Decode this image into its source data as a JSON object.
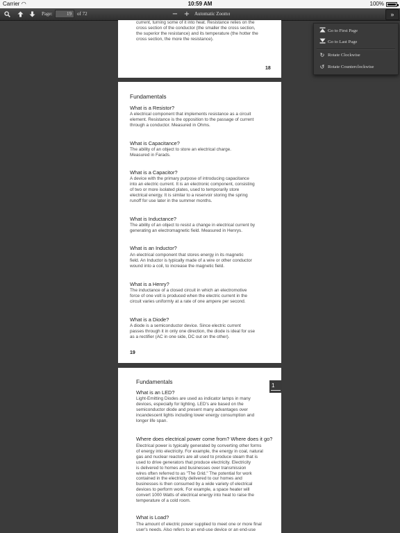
{
  "status": {
    "carrier": "Carrier",
    "time": "10:59 AM",
    "battery": "100%"
  },
  "toolbar": {
    "page_label": "Page:",
    "page_value": "19",
    "page_count": "of 72",
    "zoom_out": "−",
    "zoom_in": "+",
    "zoom": "Automatic Zoom",
    "icons": [
      "search-icon",
      "arrow-up-icon",
      "arrow-down-icon",
      "minus-icon",
      "plus-icon",
      "double-chevron-right-icon"
    ]
  },
  "menu": {
    "items": [
      {
        "label": "Go to First Page",
        "icon": "first-page-icon"
      },
      {
        "label": "Go to Last Page",
        "icon": "last-page-icon"
      },
      {
        "label": "Rotate Clockwise",
        "icon": "rotate-clockwise-icon"
      },
      {
        "label": "Rotate Counterclockwise",
        "icon": "rotate-counterclockwise-icon"
      }
    ]
  },
  "pages": {
    "p18": {
      "lines": [
        "current, turning some of it into heat. Resistance relies on the",
        "cross section of the conductor (the smaller the cross section,",
        "the superior the resistance) and its temperature (the hotter the",
        "cross section, the more the resistance)."
      ],
      "number": "18"
    },
    "p19": {
      "heading": "Fundamentals",
      "sections": [
        {
          "q": "What is a Resistor?",
          "lines": [
            "A electrical component that implements resistance as a circuit",
            "element. Resistance is the opposition to the passage of current",
            "through a conductor. Measured in Ohms."
          ]
        },
        {
          "q": "What is Capacitance?",
          "lines": [
            "The ability of an object to store an electrical charge.",
            "Measured in Farads."
          ]
        },
        {
          "q": "What is a Capacitor?",
          "lines": [
            "A device with the primary purpose of introducing capacitance",
            "into an electric current. It is an electronic component, consisting",
            "of two or more isolated plates, used to temporarily store",
            "electrical energy. It is similar to a reservoir storing the spring",
            "runoff for use later in the summer months."
          ]
        },
        {
          "q": "What is Inductance?",
          "lines": [
            "The ability of an object to resist a change in electrical current by",
            "generating an electromagnetic field. Measured in Henrys."
          ]
        },
        {
          "q": "What is an Inductor?",
          "lines": [
            "An electrical component that stores energy in its magnetic",
            "field. An Inductor is typically made of a wire or other conductor",
            "wound into a coil, to increase the magnetic field."
          ]
        },
        {
          "q": "What is a Henry?",
          "lines": [
            "The inductance of a closed circuit in which an electromotive",
            "force of one volt is produced when the electric current in the",
            "circuit varies uniformly at a rate of one ampere per second."
          ]
        },
        {
          "q": "What is a Diode?",
          "lines": [
            "A diode is a semiconductor device. Since electric current",
            "passes through it in only one direction, the diode is ideal for use",
            "as a rectifier (AC in one side, DC out on the other)."
          ]
        }
      ],
      "number": "19"
    },
    "p20": {
      "heading": "Fundamentals",
      "sections": [
        {
          "q": "What is an LED?",
          "lines": [
            "Light-Emitting Diodes are used as indicator lamps in many",
            "devices, especially for lighting. LED's are based on the",
            "semiconductor diode and present many advantages over",
            "incandescent lights including lower energy consumption and",
            "longer life span."
          ]
        },
        {
          "q": "Where does electrical power come from? Where does it go?",
          "lines": [
            "Electrical power is typically generated by converting other forms",
            "of energy into electricity. For example, the energy in coal, natural",
            "gas and nuclear reactors are all used to produce steam that is",
            "used to drive generators that produce electricity. Electricity",
            "is delivered to homes and businesses over transmission",
            "wires often referred to as \"The Grid.\" The potential for work",
            "contained in the electricity delivered to our homes and",
            "businesses is then consumed by a wide variety of electrical",
            "devices to perform work. For example, a space heater will",
            "convert 1000 Watts of electrical energy into heat to raise the",
            "temperature of a cold room."
          ]
        },
        {
          "q": "What is Load?",
          "lines": [
            "The amount of electric power supplied to meet one or more final",
            "user's needs. Also refers to an end-use device or an end-use"
          ]
        }
      ]
    }
  },
  "doc_tab": {
    "label": "1"
  }
}
